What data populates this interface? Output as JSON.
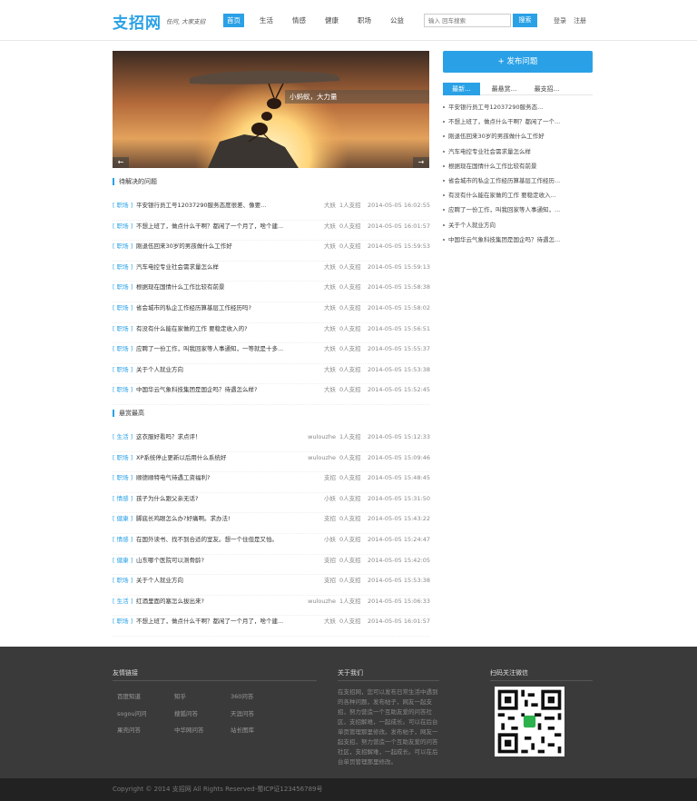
{
  "header": {
    "logo": "支招网",
    "slogan": "任问, 大家支招",
    "nav": [
      "首页",
      "生活",
      "情感",
      "健康",
      "职场",
      "公益"
    ],
    "search_placeholder": "输入 回车搜索",
    "search_button": "搜索",
    "login": "登录",
    "register": "注册"
  },
  "banner": {
    "caption": "小蚂蚁，大力量",
    "prev": "←",
    "next": "→"
  },
  "pending": {
    "title": "待解决的问题",
    "rows": [
      {
        "cat": "[ 职场 ]",
        "title": "平安银行员工号12037290服务态度很差、像要...",
        "user": "大妖",
        "answers": "1人支招",
        "time": "2014-05-05 16:02:55"
      },
      {
        "cat": "[ 职场 ]",
        "title": "不想上班了，做点什么干啊？都闲了一个月了，啥个建...",
        "user": "大妖",
        "answers": "0人支招",
        "time": "2014-05-05 16:01:57"
      },
      {
        "cat": "[ 职场 ]",
        "title": "刚退伍回来30岁的男孩做什么工作好",
        "user": "大妖",
        "answers": "0人支招",
        "time": "2014-05-05 15:59:53"
      },
      {
        "cat": "[ 职场 ]",
        "title": "汽车电控专业社会需求量怎么样",
        "user": "大妖",
        "answers": "0人支招",
        "time": "2014-05-05 15:59:13"
      },
      {
        "cat": "[ 职场 ]",
        "title": "根据现在国情什么工作比较有前景",
        "user": "大妖",
        "answers": "0人支招",
        "time": "2014-05-05 15:58:38"
      },
      {
        "cat": "[ 职场 ]",
        "title": "省会城市的私企工作经历算基层工作经历吗?",
        "user": "大妖",
        "answers": "0人支招",
        "time": "2014-05-05 15:58:02"
      },
      {
        "cat": "[ 职场 ]",
        "title": "有没有什么能在家做的工作 要稳定收入的?",
        "user": "大妖",
        "answers": "0人支招",
        "time": "2014-05-05 15:56:51"
      },
      {
        "cat": "[ 职场 ]",
        "title": "应聘了一份工作，叫我回家等人事通知，一等就是十多...",
        "user": "大妖",
        "answers": "0人支招",
        "time": "2014-05-05 15:55:37"
      },
      {
        "cat": "[ 职场 ]",
        "title": "关于个人就业方向",
        "user": "大妖",
        "answers": "0人支招",
        "time": "2014-05-05 15:53:38"
      },
      {
        "cat": "[ 职场 ]",
        "title": "中国华云气象科技集团是国企吗？待遇怎么样?",
        "user": "大妖",
        "answers": "0人支招",
        "time": "2014-05-05 15:52:45"
      }
    ]
  },
  "reward": {
    "title": "悬赏最高",
    "rows": [
      {
        "cat": "[ 生活 ]",
        "title": "这衣服好看吗？求点评！",
        "user": "wulouzhe",
        "answers": "1人支招",
        "time": "2014-05-05 15:12:33"
      },
      {
        "cat": "[ 职场 ]",
        "title": "XP系统停止更新以后用什么系统好",
        "user": "wulouzhe",
        "answers": "0人支招",
        "time": "2014-05-05 15:09:46"
      },
      {
        "cat": "[ 职场 ]",
        "title": "顺德顺特电气待遇工资福利?",
        "user": "支招",
        "answers": "0人支招",
        "time": "2014-05-05 15:48:45"
      },
      {
        "cat": "[ 情感 ]",
        "title": "孩子为什么跟父亲无话?",
        "user": "小妖",
        "answers": "0人支招",
        "time": "2014-05-05 15:31:50"
      },
      {
        "cat": "[ 健康 ]",
        "title": "脚底长鸡眼怎么办?好痛啊。求办法!",
        "user": "支招",
        "answers": "0人支招",
        "time": "2014-05-05 15:43:22"
      },
      {
        "cat": "[ 情感 ]",
        "title": "在国外读书、找不到合适的室友。想一个住但是又怕。",
        "user": "小妖",
        "answers": "0人支招",
        "time": "2014-05-05 15:24:47"
      },
      {
        "cat": "[ 健康 ]",
        "title": "山东哪个医院可以测骨龄?",
        "user": "支招",
        "answers": "0人支招",
        "time": "2014-05-05 15:42:05"
      },
      {
        "cat": "[ 职场 ]",
        "title": "关于个人就业方向",
        "user": "支招",
        "answers": "0人支招",
        "time": "2014-05-05 15:53:38"
      },
      {
        "cat": "[ 生活 ]",
        "title": "红酒里面的塞怎么拔出来?",
        "user": "wulouzhe",
        "answers": "1人支招",
        "time": "2014-05-05 15:06:33"
      },
      {
        "cat": "[ 职场 ]",
        "title": "不想上班了，做点什么干啊？都闲了一个月了，啥个建...",
        "user": "大妖",
        "answers": "0人支招",
        "time": "2014-05-05 16:01:57"
      }
    ]
  },
  "sidebar": {
    "publish": "+ 发布问题",
    "tabs": [
      "最新...",
      "最悬赏...",
      "最支招..."
    ],
    "items": [
      "平安银行员工号12037290服务态...",
      "不想上班了，做点什么干啊？都闲了一个...",
      "刚退伍回来30岁的男孩做什么工作好",
      "汽车电控专业社会需求量怎么样",
      "根据现在国情什么工作比较有前景",
      "省会城市的私企工作经历算基层工作经历...",
      "有没有什么能在家做的工作 要稳定收入...",
      "应聘了一份工作，叫我回家等人事通知，...",
      "关于个人就业方向",
      "中国华云气象科技集团是国企吗？待遇怎..."
    ]
  },
  "footer": {
    "links_title": "友情链接",
    "links": [
      "百度知道",
      "知乎",
      "360问答",
      "sogou问问",
      "搜狐问答",
      "天涯问答",
      "果壳问答",
      "中华网问答",
      "站长图库"
    ],
    "about_title": "关于我们",
    "about_text": "在支招网，您可以发布日常生活中遇到的各种问题，发布帖子，网友一起支招，努力营造一个互助友爱的问答社区，支招解难，一起成长。可以在后台单页管理那里修改。发布帖子，网友一起支招，努力营造一个互助友爱的问答社区，支招解难，一起成长。可以在后台单页管理那里修改。",
    "qr_title": "扫码关注微信",
    "copyright": "Copyright © 2014 支招网 All Rights Reserved-蜀ICP证123456789号"
  },
  "colors": {
    "accent": "#2aa1e6",
    "footer_bg": "#3a3a3a",
    "bottom_bg": "#222222"
  }
}
